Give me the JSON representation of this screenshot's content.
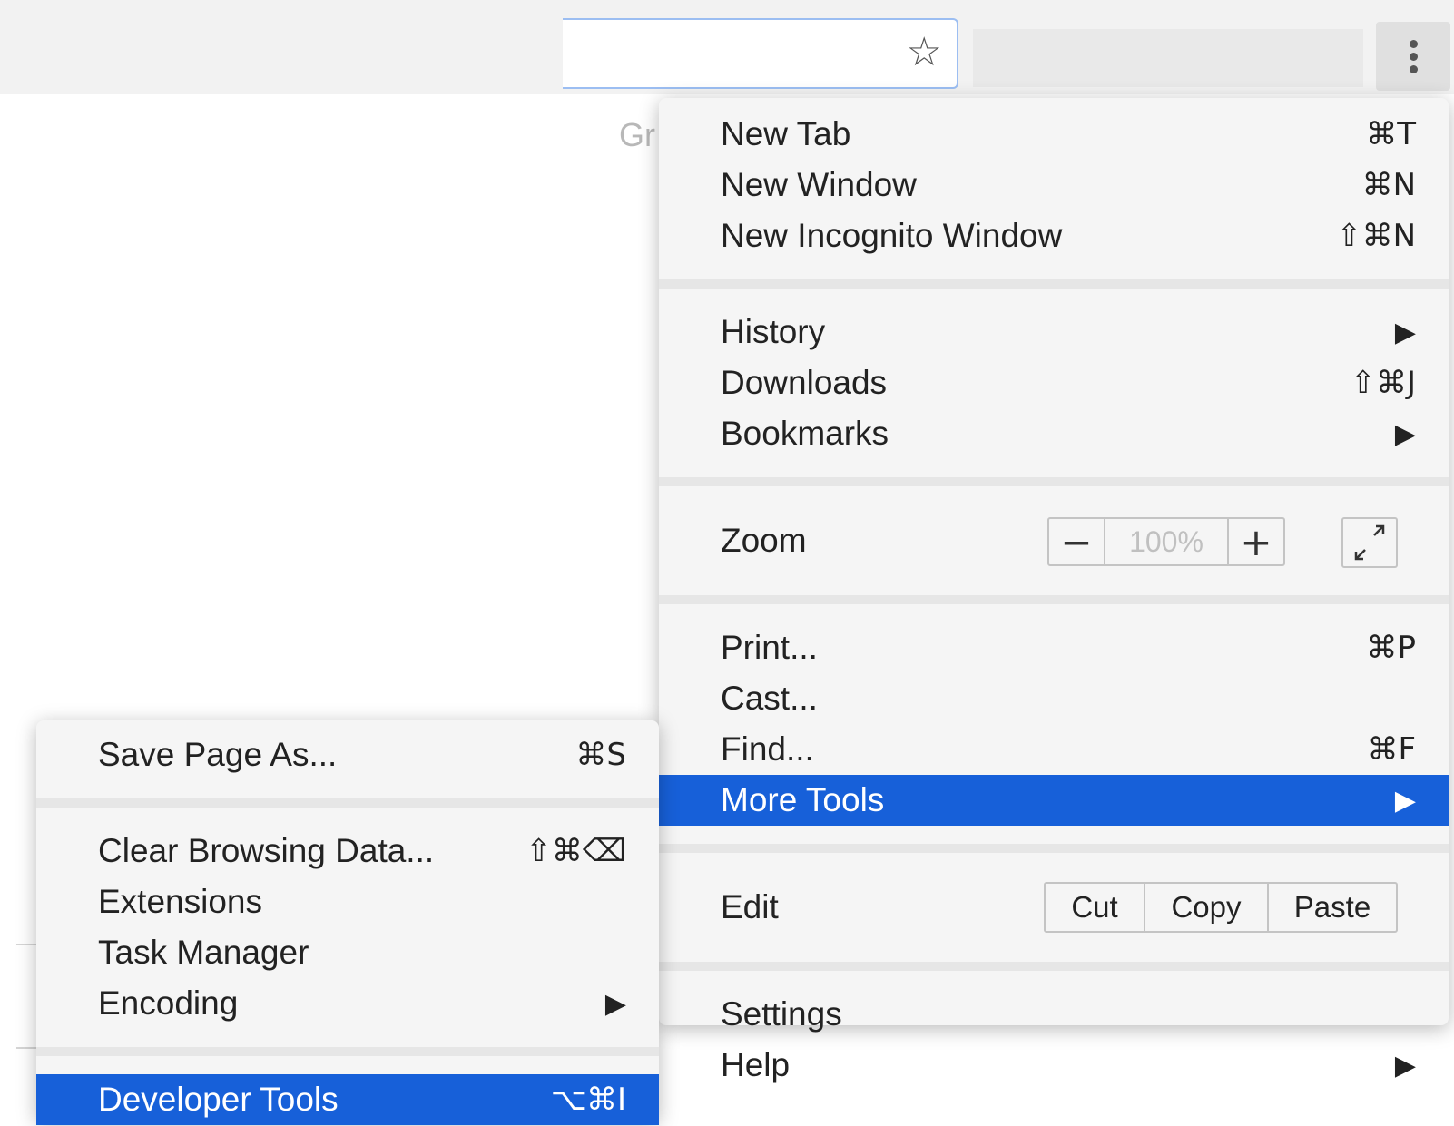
{
  "toolbar": {
    "bookmark_fragment": "Gr",
    "star_icon": "star-outline",
    "menu_icon": "three-dots-vertical"
  },
  "main_menu": {
    "new_tab": {
      "label": "New Tab",
      "shortcut": "⌘T"
    },
    "new_window": {
      "label": "New Window",
      "shortcut": "⌘N"
    },
    "new_incognito": {
      "label": "New Incognito Window",
      "shortcut": "⇧⌘N"
    },
    "history": {
      "label": "History",
      "arrow": "▶"
    },
    "downloads": {
      "label": "Downloads",
      "shortcut": "⇧⌘J"
    },
    "bookmarks": {
      "label": "Bookmarks",
      "arrow": "▶"
    },
    "zoom": {
      "label": "Zoom",
      "minus": "−",
      "value": "100%",
      "plus": "+"
    },
    "print": {
      "label": "Print...",
      "shortcut": "⌘P"
    },
    "cast": {
      "label": "Cast..."
    },
    "find": {
      "label": "Find...",
      "shortcut": "⌘F"
    },
    "more_tools": {
      "label": "More Tools",
      "arrow": "▶"
    },
    "edit": {
      "label": "Edit",
      "cut": "Cut",
      "copy": "Copy",
      "paste": "Paste"
    },
    "settings": {
      "label": "Settings"
    },
    "help": {
      "label": "Help",
      "arrow": "▶"
    }
  },
  "sub_menu": {
    "save_page": {
      "label": "Save Page As...",
      "shortcut": "⌘S"
    },
    "clear_data": {
      "label": "Clear Browsing Data...",
      "shortcut": "⇧⌘⌫"
    },
    "extensions": {
      "label": "Extensions"
    },
    "task_manager": {
      "label": "Task Manager"
    },
    "encoding": {
      "label": "Encoding",
      "arrow": "▶"
    },
    "developer_tools": {
      "label": "Developer Tools",
      "shortcut": "⌥⌘I"
    }
  },
  "colors": {
    "highlight": "#1760d9",
    "menu_bg": "#f5f5f5",
    "omnibox_border": "#9cbef2"
  }
}
